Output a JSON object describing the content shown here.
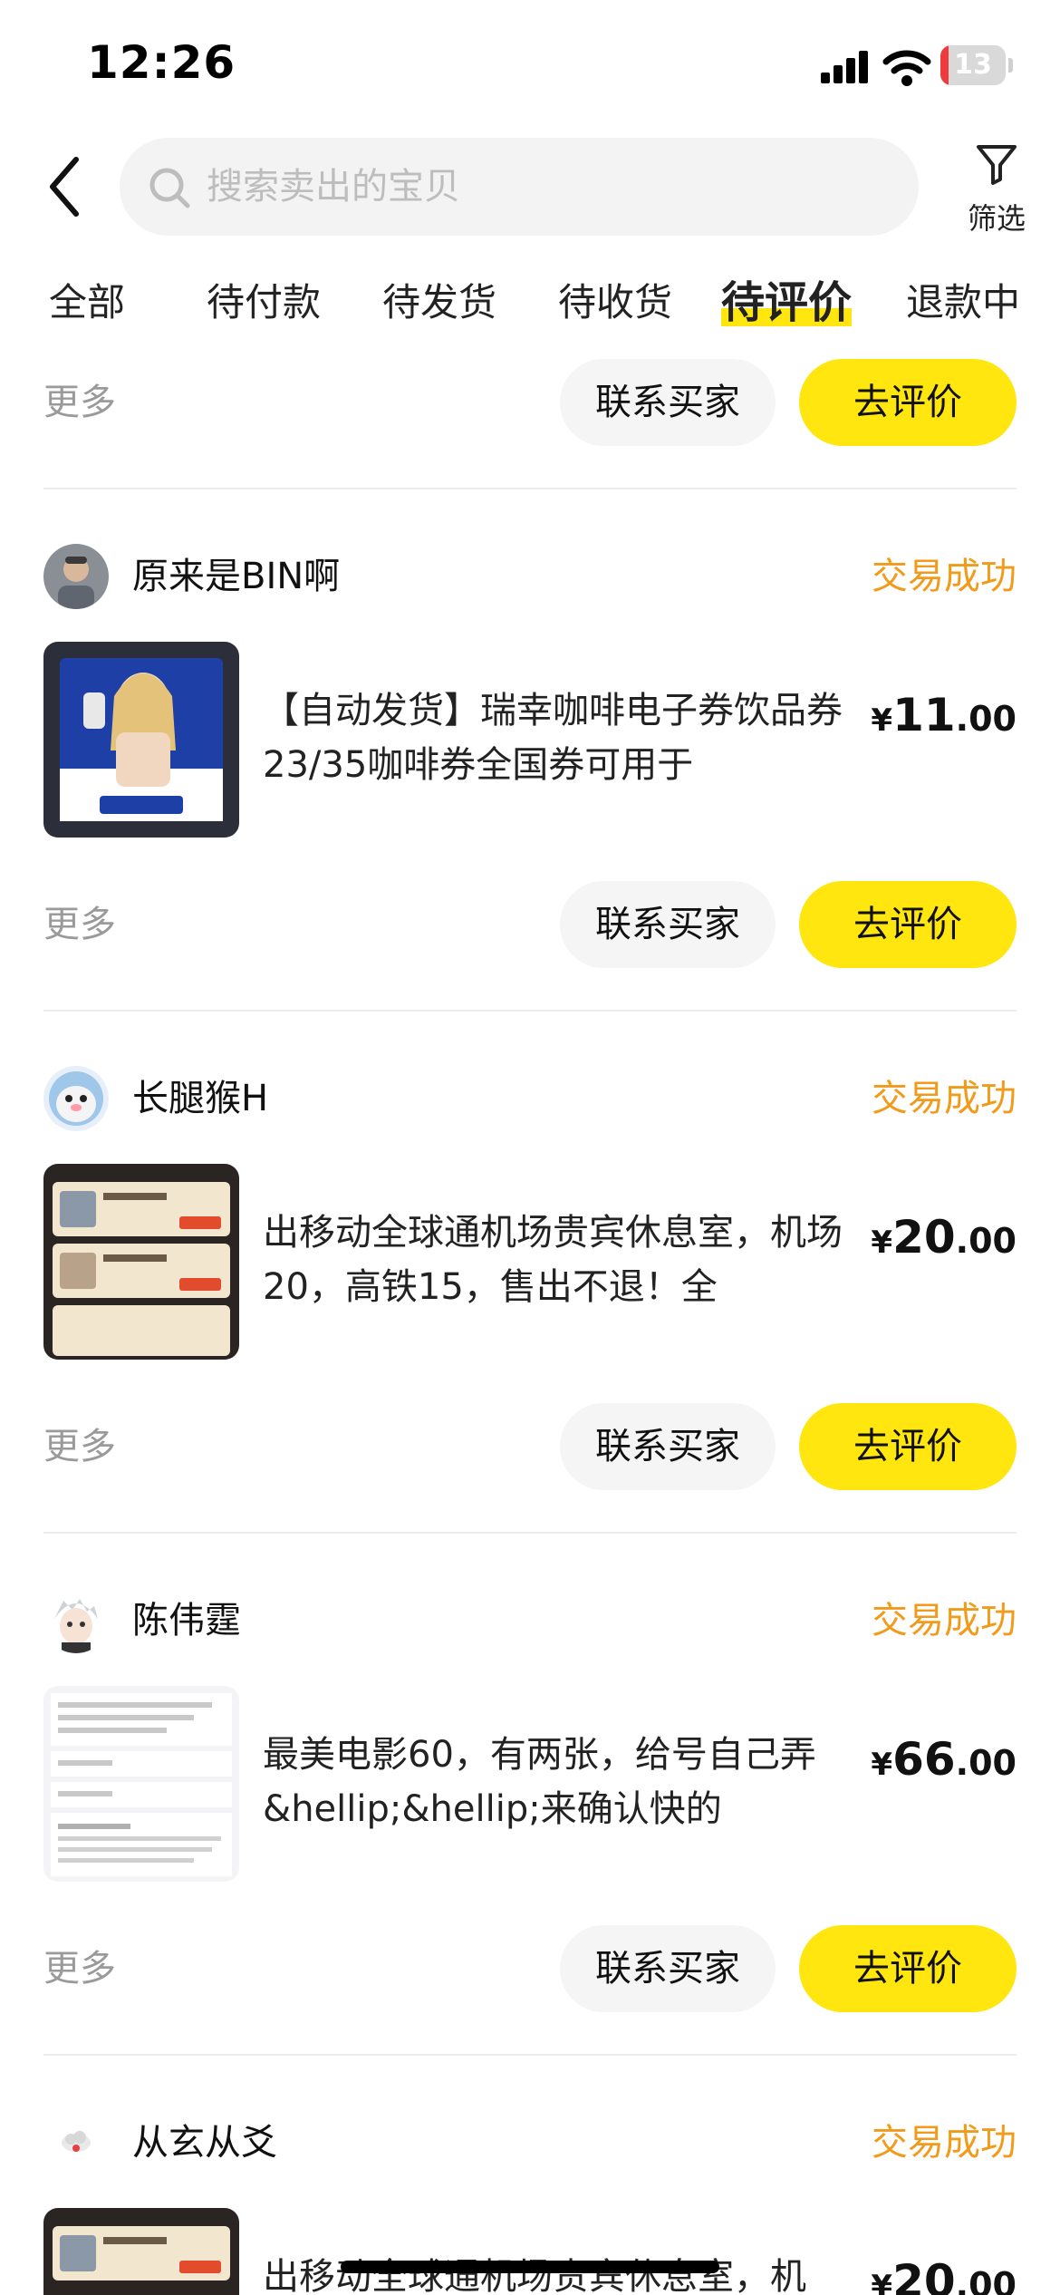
{
  "status_bar": {
    "time": "12:26",
    "battery": "13",
    "battery_level": 0.13
  },
  "header": {
    "search_placeholder": "搜索卖出的宝贝",
    "filter_label": "筛选"
  },
  "tabs": [
    {
      "label": "全部",
      "active": false
    },
    {
      "label": "待付款",
      "active": false
    },
    {
      "label": "待发货",
      "active": false
    },
    {
      "label": "待收货",
      "active": false
    },
    {
      "label": "待评价",
      "active": true
    },
    {
      "label": "退款中",
      "active": false
    }
  ],
  "actions": {
    "more": "更多",
    "contact": "联系买家",
    "review": "去评价"
  },
  "orders": [
    {
      "buyer": "原来是BIN啊",
      "status": "交易成功",
      "title": "【自动发货】瑞幸咖啡电子券饮品券23/35咖啡券全国券可用于",
      "price_symbol": "¥",
      "price_int": "11",
      "price_dec": ".00"
    },
    {
      "buyer": "长腿猴H",
      "status": "交易成功",
      "title": "出移动全球通机场贵宾休息室，机场20，高铁15，售出不退！全",
      "price_symbol": "¥",
      "price_int": "20",
      "price_dec": ".00"
    },
    {
      "buyer": "陈伟霆",
      "status": "交易成功",
      "title": "最美电影60，有两张，给号自己弄&hellip;&hellip;来确认快的",
      "price_symbol": "¥",
      "price_int": "66",
      "price_dec": ".00"
    },
    {
      "buyer": "从玄从爻",
      "status": "交易成功",
      "title": "出移动全球通机场贵宾休息室，机",
      "price_symbol": "¥",
      "price_int": "20",
      "price_dec": ".00"
    }
  ]
}
